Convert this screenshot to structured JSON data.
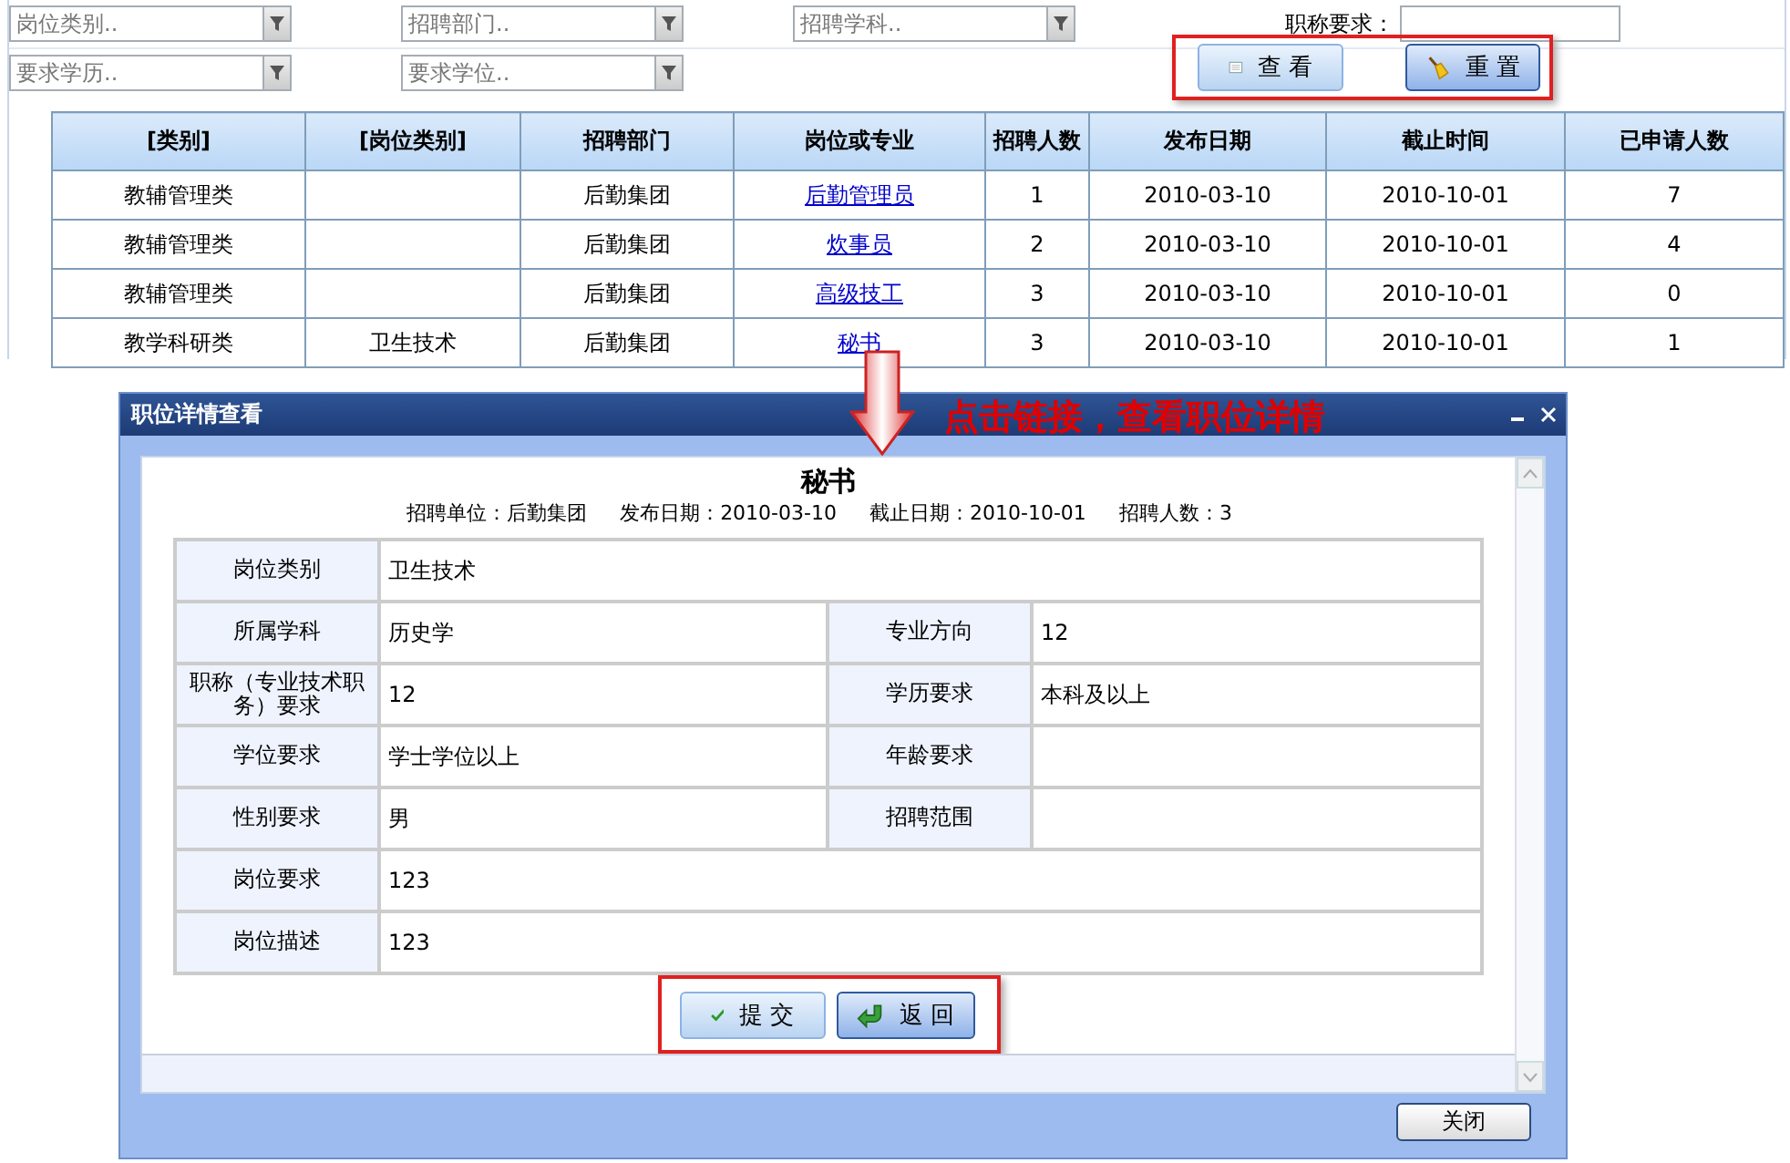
{
  "filters": [
    {
      "placeholder": "岗位类别.."
    },
    {
      "placeholder": "招聘部门.."
    },
    {
      "placeholder": "招聘学科.."
    },
    {
      "placeholder": "要求学历.."
    },
    {
      "placeholder": "要求学位.."
    }
  ],
  "title_filter": {
    "label": "职称要求："
  },
  "buttons": [
    {
      "label": "查 看",
      "kind": "view"
    },
    {
      "label": "重 置",
      "kind": "reset"
    }
  ],
  "table": {
    "columns": [
      {
        "label": "[类别]",
        "kind": "text"
      },
      {
        "label": "[岗位类别]",
        "kind": "text"
      },
      {
        "label": "招聘部门",
        "kind": "text"
      },
      {
        "label": "岗位或专业",
        "kind": "link"
      },
      {
        "label": "招聘人数",
        "kind": "text"
      },
      {
        "label": "发布日期",
        "kind": "text"
      },
      {
        "label": "截止时间",
        "kind": "text"
      },
      {
        "label": "已申请人数",
        "kind": "text"
      }
    ],
    "rows": [
      [
        "教辅管理类",
        "",
        "后勤集团",
        "后勤管理员",
        "1",
        "2010-03-10",
        "2010-10-01",
        "7"
      ],
      [
        "教辅管理类",
        "",
        "后勤集团",
        "炊事员",
        "2",
        "2010-03-10",
        "2010-10-01",
        "4"
      ],
      [
        "教辅管理类",
        "",
        "后勤集团",
        "高级技工",
        "3",
        "2010-03-10",
        "2010-10-01",
        "0"
      ],
      [
        "教学科研类",
        "卫生技术",
        "后勤集团",
        "秘书",
        "3",
        "2010-03-10",
        "2010-10-01",
        "1"
      ]
    ]
  },
  "annotation": "点击链接，查看职位详情",
  "dialog": {
    "title": "职位详情查看",
    "heading": "秘书",
    "info": [
      "招聘单位：后勤集团",
      "发布日期：2010-03-10",
      "截止日期：2010-10-01",
      "招聘人数：3"
    ],
    "fields": [
      [
        {
          "label": "岗位类别",
          "value": "卫生技术"
        }
      ],
      [
        {
          "label": "所属学科",
          "value": "历史学"
        },
        {
          "label": "专业方向",
          "value": "12"
        }
      ],
      [
        {
          "label": "职称（专业技术职务）要求",
          "value": "12"
        },
        {
          "label": "学历要求",
          "value": "本科及以上"
        }
      ],
      [
        {
          "label": "学位要求",
          "value": "学士学位以上"
        },
        {
          "label": "年龄要求"
        }
      ],
      [
        {
          "label": "性别要求",
          "value": "男"
        },
        {
          "label": "招聘范围"
        }
      ],
      [
        {
          "label": "岗位要求",
          "value": "123"
        }
      ],
      [
        {
          "label": "岗位描述",
          "value": "123"
        }
      ]
    ],
    "buttons": [
      {
        "label": "提 交",
        "kind": "submit"
      },
      {
        "label": "返 回",
        "kind": "back"
      }
    ],
    "close_button": "关闭"
  }
}
